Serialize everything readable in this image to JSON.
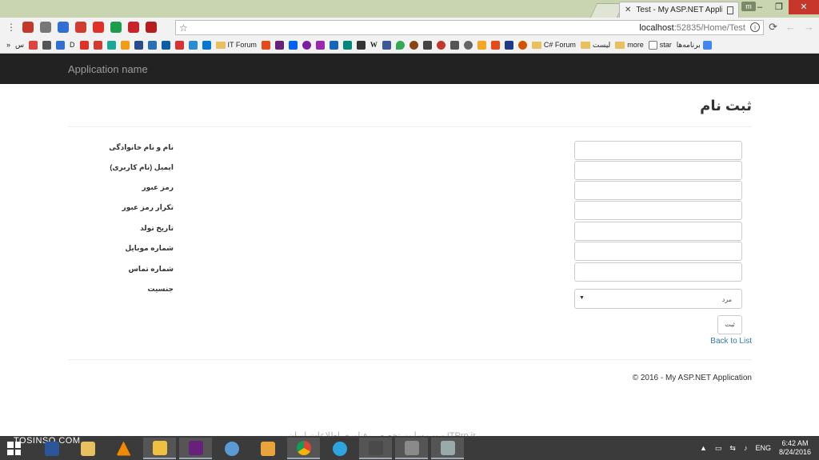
{
  "browser": {
    "tab_title": "Test - My ASP.NET Appli",
    "profile_label": "m",
    "url_host": "localhost",
    "url_path": ":52835/Home/Test",
    "window_buttons": {
      "minimize": "–",
      "restore": "❐",
      "close": "✕"
    }
  },
  "bookmarks": {
    "items": [
      {
        "label": "",
        "color": "#e0443e"
      },
      {
        "label": "",
        "color": "#555"
      },
      {
        "label": "",
        "color": "#2f6fd6"
      },
      {
        "label": "",
        "color": "#d23b2f"
      },
      {
        "label": "",
        "color": "#e34234"
      },
      {
        "label": "",
        "color": "#1a9e4a"
      },
      {
        "label": "",
        "color": "#e03127"
      },
      {
        "label": "",
        "color": "#c8222a"
      },
      {
        "label": "IT Forum",
        "color": "folder"
      },
      {
        "label": "C# Forum",
        "color": "folder"
      },
      {
        "label": "لیست",
        "color": "folder"
      },
      {
        "label": "more",
        "color": "folder"
      },
      {
        "label": "star",
        "color": "page"
      },
      {
        "label": "برنامه‌ها",
        "color": "apps"
      }
    ],
    "prefix_label": "س",
    "overflow": "»",
    "d_label": "D"
  },
  "site": {
    "brand": "Application name",
    "page_title": "ثبت نام",
    "fields": [
      {
        "label": "نام و نام خانوادگی",
        "value": ""
      },
      {
        "label": "ایمیل (نام کاربری)",
        "value": ""
      },
      {
        "label": "رمز عبور",
        "value": ""
      },
      {
        "label": "تکرار رمز عبور",
        "value": ""
      },
      {
        "label": "تاریخ تولد",
        "value": ""
      },
      {
        "label": "شماره موبایل",
        "value": ""
      },
      {
        "label": "شماره تماس",
        "value": ""
      }
    ],
    "gender_label": "جنسیت",
    "gender_value": "مرد",
    "submit_label": "ثبت",
    "back_link": "Back to List",
    "footer": "© 2016 - My ASP.NET Application"
  },
  "watermark": "ITPro.ir - وب سایت تخصصی فناوری اطلاعات ایران",
  "taskbar": {
    "brand_overlay": "TOSINSO.COM",
    "language": "ENG",
    "time": "6:42 AM",
    "date": "8/24/2016"
  }
}
